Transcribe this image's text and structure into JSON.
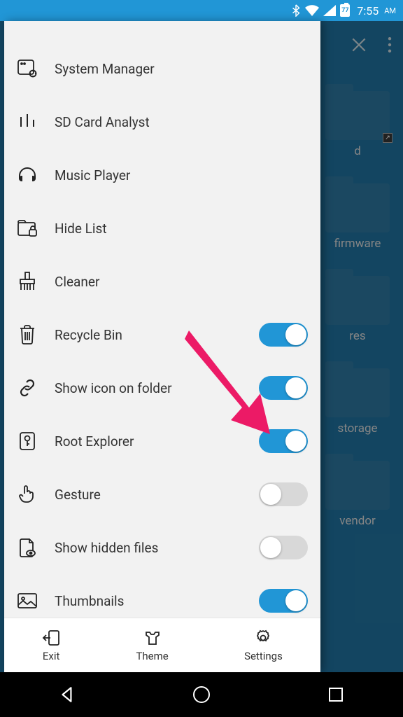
{
  "status": {
    "battery": "77",
    "time": "7:55",
    "ampm": "AM"
  },
  "background_folders": [
    {
      "label": "d",
      "has_link": true
    },
    {
      "label": "firmware",
      "has_link": false
    },
    {
      "label": "res",
      "has_link": false
    },
    {
      "label": "storage",
      "has_link": false
    },
    {
      "label": "vendor",
      "has_link": false
    }
  ],
  "drawer": {
    "items": [
      {
        "label": "System Manager",
        "icon": "system-manager",
        "toggle": null
      },
      {
        "label": "SD Card Analyst",
        "icon": "analyst",
        "toggle": null
      },
      {
        "label": "Music Player",
        "icon": "headphones",
        "toggle": null
      },
      {
        "label": "Hide List",
        "icon": "hide-list",
        "toggle": null
      },
      {
        "label": "Cleaner",
        "icon": "cleaner",
        "toggle": null
      },
      {
        "label": "Recycle Bin",
        "icon": "trash",
        "toggle": true
      },
      {
        "label": "Show icon on folder",
        "icon": "link",
        "toggle": true
      },
      {
        "label": "Root Explorer",
        "icon": "key",
        "toggle": true
      },
      {
        "label": "Gesture",
        "icon": "gesture",
        "toggle": false
      },
      {
        "label": "Show hidden files",
        "icon": "hidden-file",
        "toggle": false
      },
      {
        "label": "Thumbnails",
        "icon": "thumbnails",
        "toggle": true
      }
    ],
    "footer": [
      {
        "label": "Exit",
        "icon": "exit"
      },
      {
        "label": "Theme",
        "icon": "theme"
      },
      {
        "label": "Settings",
        "icon": "settings"
      }
    ]
  },
  "annotation_arrow_target": "Root Explorer"
}
